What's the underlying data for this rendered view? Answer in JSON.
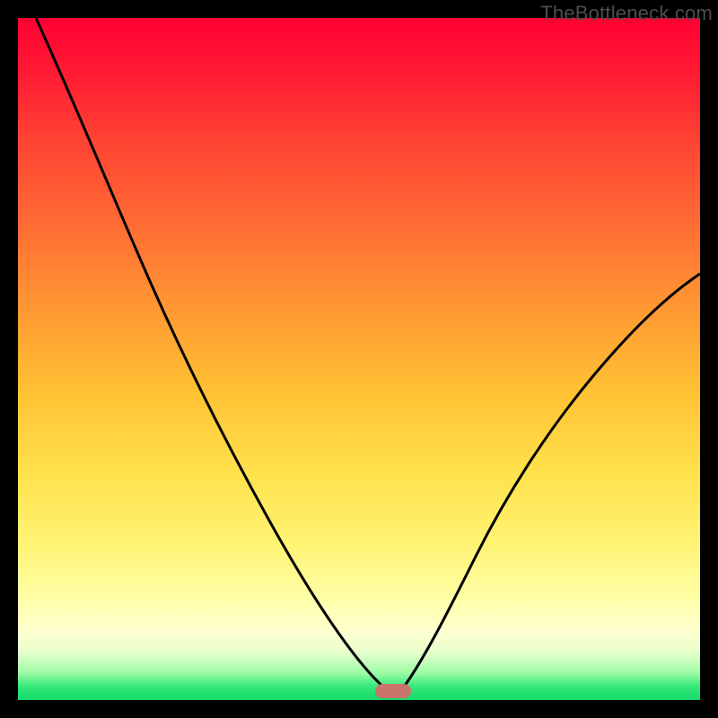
{
  "watermark": "TheBottleneck.com",
  "colors": {
    "frame": "#000000",
    "gradient_top": "#ff0033",
    "gradient_mid1": "#ff9633",
    "gradient_mid2": "#ffe24d",
    "gradient_low": "#ffffd0",
    "gradient_bottom": "#14d96a",
    "curve_stroke": "#000000",
    "marker_fill": "#c9746b",
    "watermark_text": "#4d4d4d"
  },
  "chart_data": {
    "type": "line",
    "title": "",
    "xlabel": "",
    "ylabel": "",
    "xlim": [
      0,
      100
    ],
    "ylim": [
      0,
      100
    ],
    "x": [
      0,
      3,
      7,
      11,
      16,
      22,
      28,
      34,
      40,
      45,
      49,
      52,
      54,
      55,
      56,
      58,
      60,
      62,
      65,
      68,
      72,
      76,
      80,
      85,
      90,
      95,
      100
    ],
    "values": [
      100,
      94,
      87,
      80,
      72,
      63,
      54,
      44,
      33,
      23,
      14,
      8,
      4,
      1,
      0,
      2,
      6,
      11,
      17,
      23,
      30,
      36,
      42,
      48,
      53,
      58,
      62
    ],
    "marker": {
      "x": 55,
      "y": 0
    },
    "notes": "V-shaped bottleneck curve on red→green vertical gradient; minimum at x≈55; values estimated from pixel positions (no axis labels present)."
  }
}
